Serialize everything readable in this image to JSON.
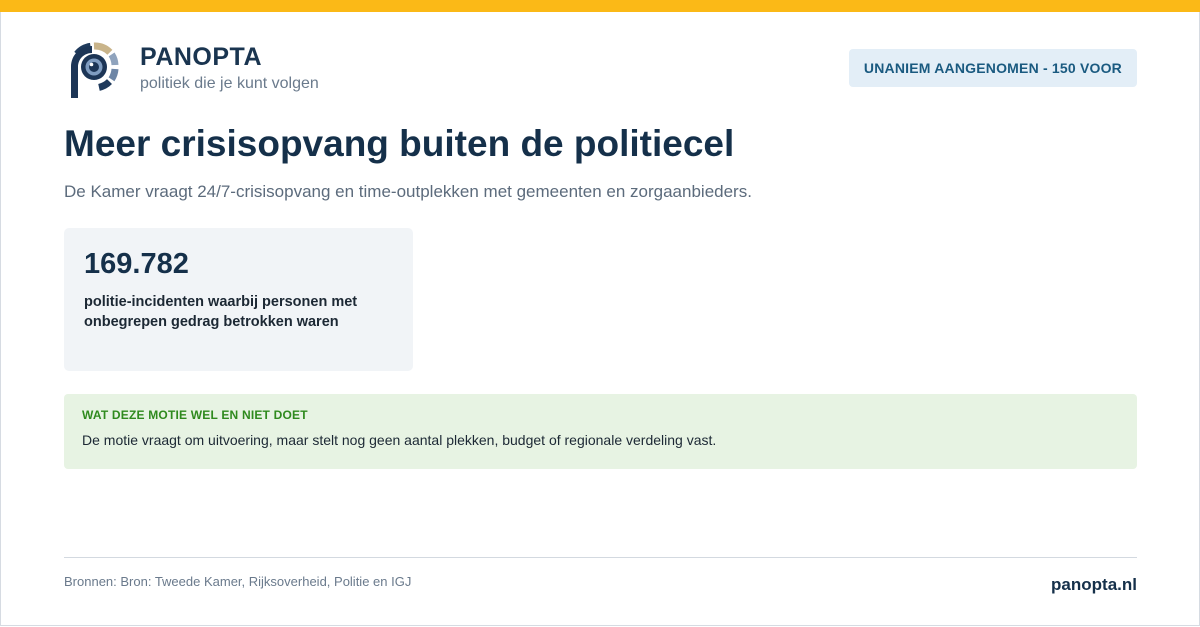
{
  "brand": {
    "name": "PANOPTA",
    "tagline": "politiek die je kunt volgen",
    "logo_icon": "panopta-eye-logo-icon"
  },
  "status_badge": "UNANIEM AANGENOMEN - 150 VOOR",
  "title": "Meer crisisopvang buiten de politiecel",
  "subtitle": "De Kamer vraagt 24/7-crisisopvang en time-outplekken met gemeenten en zorgaanbieders.",
  "stat": {
    "value": "169.782",
    "label": "politie-incidenten waarbij personen met onbegrepen gedrag betrokken waren"
  },
  "info": {
    "heading": "WAT DEZE MOTIE WEL EN NIET DOET",
    "text": "De motie vraagt om uitvoering, maar stelt nog geen aantal plekken, budget of regionale verdeling vast."
  },
  "footer": {
    "sources": "Bronnen: Bron: Tweede Kamer, Rijksoverheid, Politie en IGJ",
    "site": "panopta.nl"
  },
  "colors": {
    "accent_bar": "#fbb917",
    "title": "#15304a",
    "badge_bg": "#e3eef7",
    "badge_text": "#1a5a80",
    "info_bg": "#e7f3e3",
    "info_heading": "#2f8a1e",
    "card_bg": "#f1f4f7"
  }
}
